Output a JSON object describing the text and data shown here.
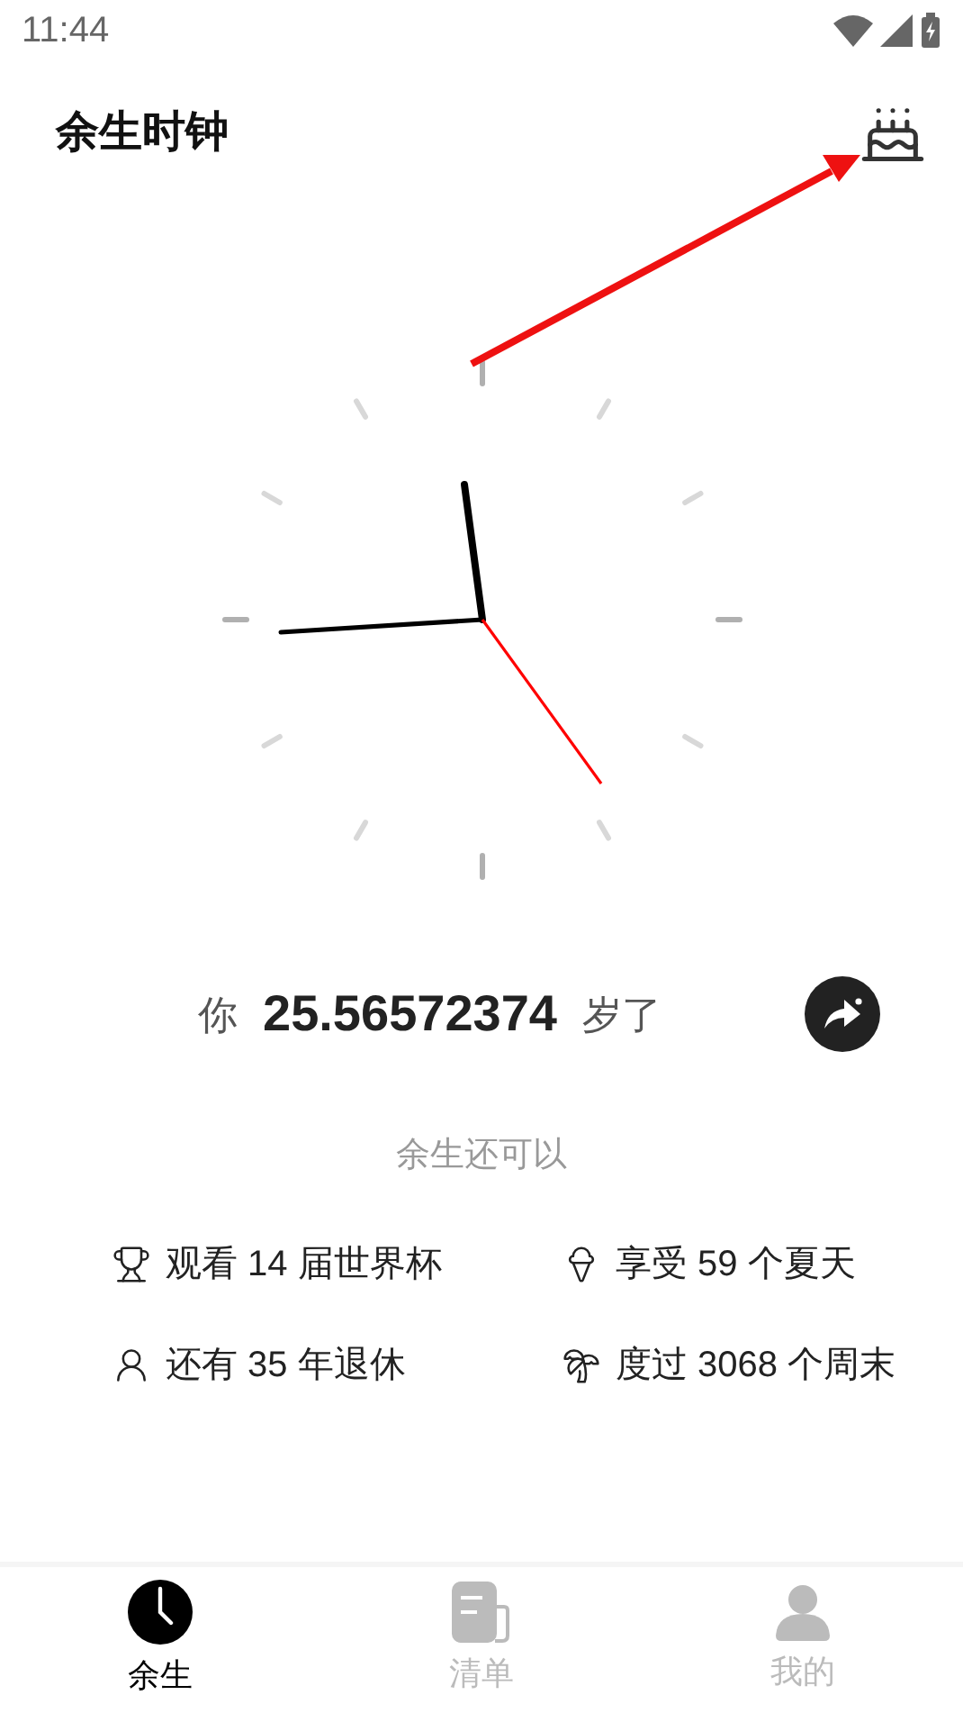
{
  "status_bar": {
    "time": "11:44"
  },
  "header": {
    "title": "余生时钟"
  },
  "age": {
    "prefix": "你",
    "value": "25.56572374",
    "suffix": "岁了"
  },
  "remaining": {
    "heading": "余生还可以",
    "items": [
      {
        "kind": "trophy",
        "text": "观看 14 届世界杯"
      },
      {
        "kind": "icecream",
        "text": "享受 59 个夏天"
      },
      {
        "kind": "retire",
        "text": "还有 35 年退休"
      },
      {
        "kind": "palm",
        "text": "度过 3068 个周末"
      }
    ]
  },
  "tabs": [
    {
      "kind": "clock",
      "label": "余生",
      "selected": true
    },
    {
      "kind": "list",
      "label": "清单",
      "selected": false
    },
    {
      "kind": "person",
      "label": "我的",
      "selected": false
    }
  ]
}
